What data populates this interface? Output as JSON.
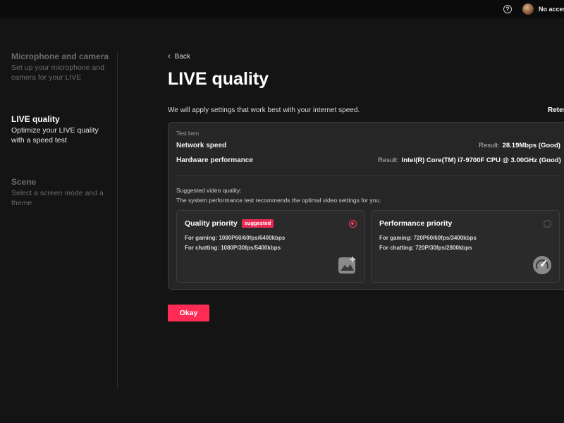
{
  "topbar": {
    "help_icon": "help-circle-icon",
    "access_label": "No acces"
  },
  "sidebar": {
    "items": [
      {
        "title": "Microphone and camera",
        "description": "Set up your microphone and camera for your LIVE",
        "active": false
      },
      {
        "title": "LIVE quality",
        "description": "Optimize your LIVE quality with a speed test",
        "active": true
      },
      {
        "title": "Scene",
        "description": "Select a screen mode and a theme",
        "active": false
      }
    ]
  },
  "main": {
    "back_label": "Back",
    "title": "LIVE quality",
    "intro": "We will apply settings that work best with your internet speed.",
    "retest_label": "Retes",
    "test_item_label": "Test item",
    "result_prefix": "Result:",
    "tests": [
      {
        "label": "Network speed",
        "result": "28.19Mbps (Good)"
      },
      {
        "label": "Hardware performance",
        "result": "Intel(R) Core(TM) i7-9700F CPU @ 3.00GHz (Good)"
      }
    ],
    "suggested_label": "Suggested video quality:",
    "suggested_desc": "The system performance test recommends the optimal video settings for you.",
    "options": [
      {
        "title": "Quality priority",
        "badge": "suggested",
        "gaming": "For gaming: 1080P60/60fps/6400kbps",
        "chatting": "For chatting: 1080P/30fps/5400kbps",
        "selected": true,
        "icon": "image-sparkle-icon"
      },
      {
        "title": "Performance priority",
        "badge": "",
        "gaming": "For gaming: 720P60/60fps/3400kbps",
        "chatting": "For chatting: 720P/30fps/2800kbps",
        "selected": false,
        "icon": "speedometer-icon"
      }
    ],
    "okay_label": "Okay"
  },
  "colors": {
    "background": "#141414",
    "accent": "#fe2c55",
    "panel": "#262626"
  }
}
